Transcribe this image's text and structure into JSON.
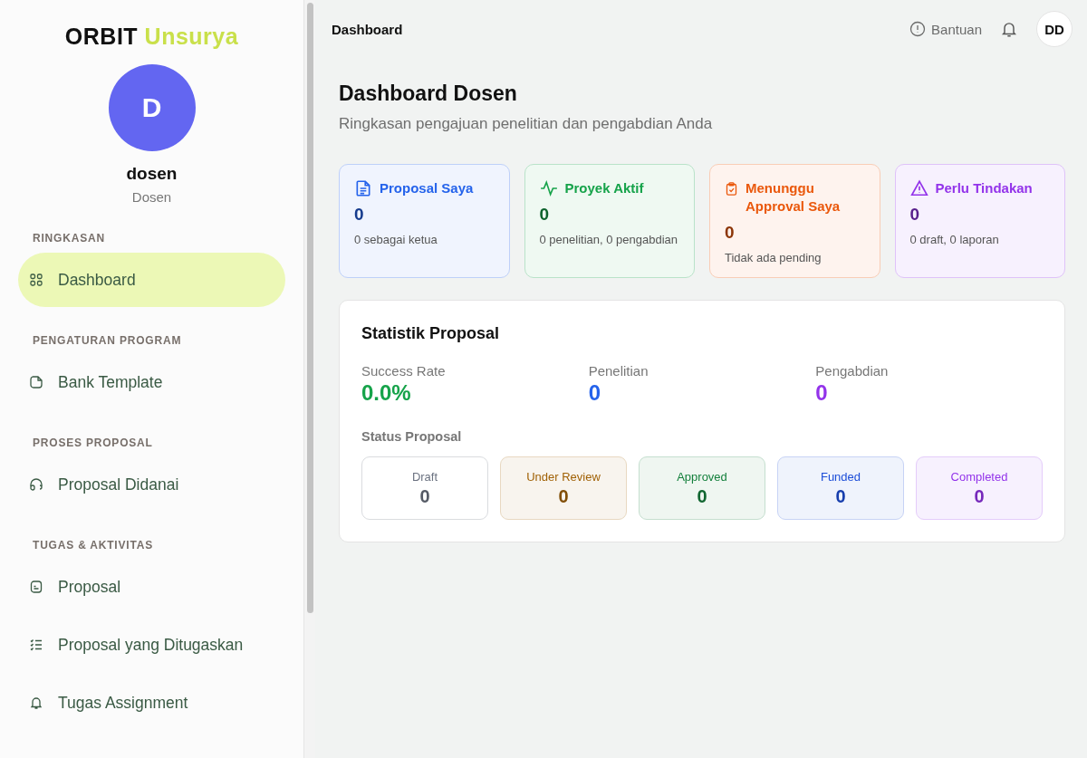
{
  "sidebar": {
    "logo": {
      "name": "ORBIT",
      "accent": "Unsurya"
    },
    "user": {
      "initial": "D",
      "name": "dosen",
      "role": "Dosen"
    },
    "sections": [
      {
        "heading": "RINGKASAN",
        "items": [
          {
            "label": "Dashboard",
            "selected": true
          }
        ]
      },
      {
        "heading": "PENGATURAN PROGRAM",
        "items": [
          {
            "label": "Bank Template",
            "selected": false
          }
        ]
      },
      {
        "heading": "PROSES PROPOSAL",
        "items": [
          {
            "label": "Proposal Didanai",
            "selected": false
          }
        ]
      },
      {
        "heading": "TUGAS & AKTIVITAS",
        "items": [
          {
            "label": "Proposal",
            "selected": false
          },
          {
            "label": "Proposal yang Ditugaskan",
            "selected": false
          },
          {
            "label": "Tugas Assignment",
            "selected": false
          }
        ]
      }
    ]
  },
  "topbar": {
    "breadcrumb": "Dashboard",
    "help": "Bantuan",
    "avatar": "DD"
  },
  "page": {
    "title": "Dashboard Dosen",
    "subtitle": "Ringkasan pengajuan penelitian dan pengabdian Anda"
  },
  "summary_cards": [
    {
      "title": "Proposal Saya",
      "value": "0",
      "note": "0 sebagai ketua",
      "color": "#2563eb"
    },
    {
      "title": "Proyek Aktif",
      "value": "0",
      "note": "0 penelitian, 0 pengabdian",
      "color": "#16a34a"
    },
    {
      "title": "Menunggu Approval Saya",
      "value": "0",
      "note": "Tidak ada pending",
      "color": "#ea580c"
    },
    {
      "title": "Perlu Tindakan",
      "value": "0",
      "note": "0 draft, 0 laporan",
      "color": "#9333ea"
    }
  ],
  "statistics": {
    "title": "Statistik Proposal",
    "metrics": [
      {
        "label": "Success Rate",
        "value": "0.0%",
        "color": "#16a34a"
      },
      {
        "label": "Penelitian",
        "value": "0",
        "color": "#2563eb"
      },
      {
        "label": "Pengabdian",
        "value": "0",
        "color": "#9333ea"
      }
    ],
    "status_title": "Status Proposal",
    "statuses": [
      {
        "label": "Draft",
        "value": "0",
        "color": "#6b7280"
      },
      {
        "label": "Under Review",
        "value": "0",
        "color": "#a16207"
      },
      {
        "label": "Approved",
        "value": "0",
        "color": "#15803d"
      },
      {
        "label": "Funded",
        "value": "0",
        "color": "#1d4ed8"
      },
      {
        "label": "Completed",
        "value": "0",
        "color": "#9333ea"
      }
    ]
  }
}
